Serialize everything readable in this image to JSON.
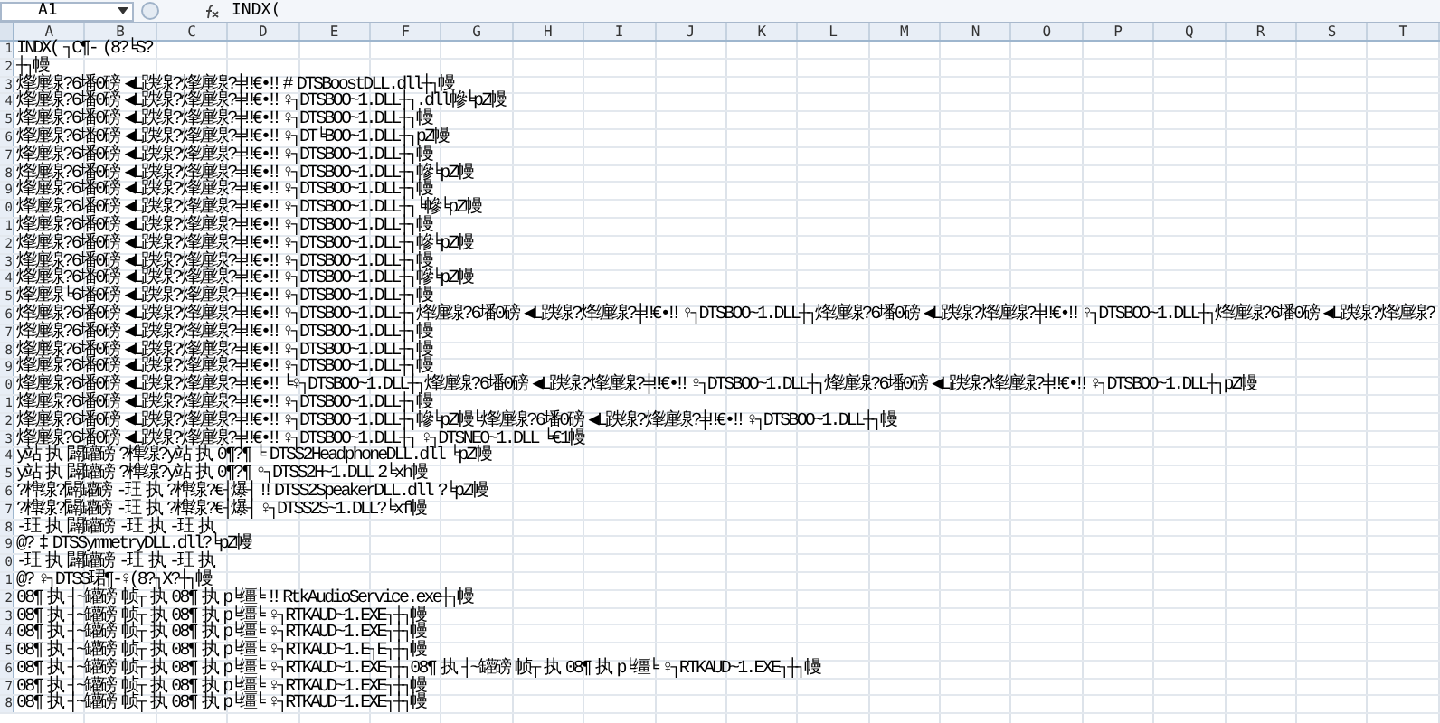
{
  "formula_bar": {
    "name_box": "A1",
    "formula": "INDX("
  },
  "columns": [
    "A",
    "B",
    "C",
    "D",
    "E",
    "F",
    "G",
    "H",
    "I",
    "J",
    "K",
    "L",
    "M",
    "N",
    "O",
    "P",
    "Q",
    "R",
    "S",
    "T"
  ],
  "rows": [
    {
      "header": "1",
      "cells": [
        "INDX(",
        "┐C¶-",
        "(8?╘S?"
      ]
    },
    {
      "header": "2",
      "cells": [
        "┼┐幔"
      ]
    },
    {
      "header": "3",
      "cells": [
        "烽缠缐?6墦0磅",
        "◀L跌缐?烽缠缐?╪‼€•‼",
        "#",
        "DTSBoostDLL.dll┼┐幔"
      ]
    },
    {
      "header": "4",
      "cells": [
        "烽缠缐?6墦0磅",
        "◀L跌缐?烽缠缐?╪‼€•‼",
        "♀┐DTSBOO~1.DLL┼┐.dll幓╘pZ幔"
      ]
    },
    {
      "header": "5",
      "cells": [
        "烽缠缐?6墦0磅",
        "◀L跌缐?烽缠缐?╪‼€•‼",
        "♀┐DTSBOO~1.DLL┼┐幔"
      ]
    },
    {
      "header": "6",
      "cells": [
        "烽缠缐?6墦0磅",
        "◀L跌缐?烽缠缐?╪‼€•‼",
        "♀┐DT╘BOO~1.DLL┼┐pZ幔"
      ]
    },
    {
      "header": "7",
      "cells": [
        "烽缠缐?6墦0磅",
        "◀L跌缐?烽缠缐?╪‼€•‼",
        "♀┐DTSBOO~1.DLL┼┐幔"
      ]
    },
    {
      "header": "8",
      "cells": [
        "烽缠缐?6墦0磅",
        "◀L跌缐?烽缠缐?╪‼€•‼",
        "♀┐DTSBOO~1.DLL┼┐幓╘pZ幔"
      ]
    },
    {
      "header": "9",
      "cells": [
        "烽缠缐?6墦0磅",
        "◀L跌缐?烽缠缐?╪‼€•‼",
        "♀┐DTSBOO~1.DLL┼┐幔"
      ]
    },
    {
      "header": "0",
      "cells": [
        "烽缠缐?6墦0磅",
        "◀L跌缐?烽缠缐?╪‼€•‼",
        "♀┐DTSBOO~1.DLL┼┐╘幓╘pZ幔"
      ]
    },
    {
      "header": "1",
      "cells": [
        "烽缠缐?6墦0磅",
        "◀L跌缐?烽缠缐?╪‼€•‼",
        "♀┐DTSBOO~1.DLL┼┐幔"
      ]
    },
    {
      "header": "2",
      "cells": [
        "烽缠缐?6墦0磅",
        "◀L跌缐?烽缠缐?╪‼€•‼",
        "♀┐DTSBOO~1.DLL┼┐幓╘pZ幔"
      ]
    },
    {
      "header": "3",
      "cells": [
        "烽缠缐?6墦0磅",
        "◀L跌缐?烽缠缐?╪‼€•‼",
        "♀┐DTSBOO~1.DLL┼┐幔"
      ]
    },
    {
      "header": "4",
      "cells": [
        "烽缠缐?6墦0磅",
        "◀L跌缐?烽缠缐?╪‼€•‼",
        "♀┐DTSBOO~1.DLL┼┐幓╘pZ幔"
      ]
    },
    {
      "header": "5",
      "cells": [
        "烽缠缐╘6墦0磅",
        "◀L跌缐?烽缠缐?╪‼€•‼",
        "♀┐DTSBOO~1.DLL┼┐幔"
      ]
    },
    {
      "header": "6",
      "cells": [
        "烽缠缐?6墦0磅",
        "◀L跌缐?烽缠缐?╪‼€•‼",
        "♀┐DTSBOO~1.DLL┼┐烽缠缐?6墦0磅",
        "◀L跌缐?烽缠缐?╪‼€•‼",
        "♀┐DTSBOO~1.DLL┼┐烽缠缐?6墦0磅",
        "◀L跌缐?烽缠缐?╪‼€•‼",
        "♀┐DTSBOO~1.DLL┼┐烽缠缐?6墦0磅",
        "◀L跌缐?烽缠缐?"
      ]
    },
    {
      "header": "7",
      "cells": [
        "烽缠缐?6墦0磅",
        "◀L跌缐?烽缠缐?╪‼€•‼",
        "♀┐DTSBOO~1.DLL┼┐幔"
      ]
    },
    {
      "header": "8",
      "cells": [
        "烽缠缐?6墦0磅",
        "◀L跌缐?烽缠缐?╪‼€•‼",
        "♀┐DTSBOO~1.DLL┼┐幔"
      ]
    },
    {
      "header": "9",
      "cells": [
        "烽缠缐?6墦0磅",
        "◀L跌缐?烽缠缐?╪‼€•‼",
        "♀┐DTSBOO~1.DLL┼┐幔"
      ]
    },
    {
      "header": "0",
      "cells": [
        "烽缠缐?6墦0磅",
        "◀L跌缐?烽缠缐?╪‼€•‼",
        "╘♀┐DTSBOO~1.DLL┼┐烽缠缐?6墦0磅",
        "◀L跌缐?烽缠缐?╪‼€•‼",
        "♀┐DTSBOO~1.DLL┼┐烽缠缐?6墦0磅",
        "◀L跌缐?烽缠缐?╪‼€•‼",
        "♀┐DTSBOO~1.DLL┼┐pZ幔"
      ]
    },
    {
      "header": "1",
      "cells": [
        "烽缠缐?6墦0磅",
        "◀L跌缐?烽缠缐?╪‼€•‼",
        "♀┐DTSBOO~1.DLL┼┐幔"
      ]
    },
    {
      "header": "2",
      "cells": [
        "烽缠缐?6墦0磅",
        "◀L跌缐?烽缠缐?╪‼€•‼",
        "♀┐DTSBOO~1.DLL┼┐幓╘pZ幔╘烽缠缐?6墦0磅",
        "◀L跌缐?烽缠缐?╪‼€•‼",
        "♀┐DTSBOO~1.DLL┼┐幔"
      ]
    },
    {
      "header": "3",
      "cells": [
        "烽缠缐?6墦0磅",
        "◀L跌缐?烽缠缐?╪‼€•‼",
        "♀┐DTSBOO~1.DLL┼┐",
        "♀┐DTSNEO~1.DLL",
        "╘€1幔"
      ]
    },
    {
      "header": "4",
      "cells": [
        "y站",
        "执",
        "闢罐磅",
        "?榫缐?y站",
        "执",
        "0¶?¶",
        "╘",
        "DTSS2HeadphoneDLL.dll",
        "╘pZ幔"
      ]
    },
    {
      "header": "5",
      "cells": [
        "y站",
        "执",
        "闢罐磅",
        "?榫缐?y站",
        "执",
        "0¶?¶",
        "♀┐DTSS2H~1.DLL",
        "2╘xh幔"
      ]
    },
    {
      "header": "6",
      "cells": [
        "?榫缐?闢罐磅",
        "-玨",
        "执",
        "?榫缐?€┤爆┤",
        "‼",
        "DTSS2SpeakerDLL.dll",
        "?╘pZ幔"
      ]
    },
    {
      "header": "7",
      "cells": [
        "?榫缐?闢罐磅",
        "-玨",
        "执",
        "?榫缐?€┤爆┤",
        "♀┐DTSS2S~1.DLL?╘xf幔"
      ]
    },
    {
      "header": "8",
      "cells": [
        "-玨",
        "执",
        "闢罐磅",
        "-玨",
        "执",
        "-玨",
        "执"
      ]
    },
    {
      "header": "9",
      "cells": [
        "@?",
        "‡",
        "DTSSymmetryDLL.dll?╘pZ幔"
      ]
    },
    {
      "header": "0",
      "cells": [
        "-玨",
        "执",
        "闢罐磅",
        "-玨",
        "执",
        "-玨",
        "执"
      ]
    },
    {
      "header": "1",
      "cells": [
        "@?",
        "♀┐DTSS珺¶-♀(8?┐X?┼┐幔"
      ]
    },
    {
      "header": "2",
      "cells": [
        "08¶",
        "执",
        "┤~罐磅",
        "帧┬",
        "执",
        "08¶",
        "执",
        "p╘缰╘",
        "‼",
        "RtkAudioService.exe┼┐幔"
      ]
    },
    {
      "header": "3",
      "cells": [
        "08¶",
        "执",
        "┤~罐磅",
        "帧┬",
        "执",
        "08¶",
        "执",
        "p╘缰╘",
        "♀┐RTKAUD~1.EXE┐┼┐幔"
      ]
    },
    {
      "header": "4",
      "cells": [
        "08¶",
        "执",
        "┤~罐磅",
        "帧┬",
        "执",
        "08¶",
        "执",
        "p╘缰╘",
        "♀┐RTKAUD~1.EXE┐┼┐幔"
      ]
    },
    {
      "header": "5",
      "cells": [
        "08¶",
        "执",
        "┤~罐磅",
        "帧┬",
        "执",
        "08¶",
        "执",
        "p╘缰╘",
        "♀┐RTKAUD~1.E┐E┐┼┐幔"
      ]
    },
    {
      "header": "6",
      "cells": [
        "08¶",
        "执",
        "┤~罐磅",
        "帧┬",
        "执",
        "08¶",
        "执",
        "p╘缰╘",
        "♀┐RTKAUD~1.EXE┐┼┐08¶",
        "执",
        "┤~罐磅",
        "帧┬",
        "执",
        "08¶",
        "执",
        "p╘缰╘",
        "♀┐RTKAUD~1.EXE┐┼┐幔"
      ]
    },
    {
      "header": "7",
      "cells": [
        "08¶",
        "执",
        "┤~罐磅",
        "帧┬",
        "执",
        "08¶",
        "执",
        "p╘缰╘",
        "♀┐RTKAUD~1.EXE┐┼┐幔"
      ]
    },
    {
      "header": "8",
      "cells": [
        "08¶",
        "执",
        "┤~罐磅",
        "帧┬",
        "执",
        "08¶",
        "执",
        "p╘缰╘",
        "♀┐RTKAUD~1.EXE┐┼┐幔"
      ]
    }
  ]
}
